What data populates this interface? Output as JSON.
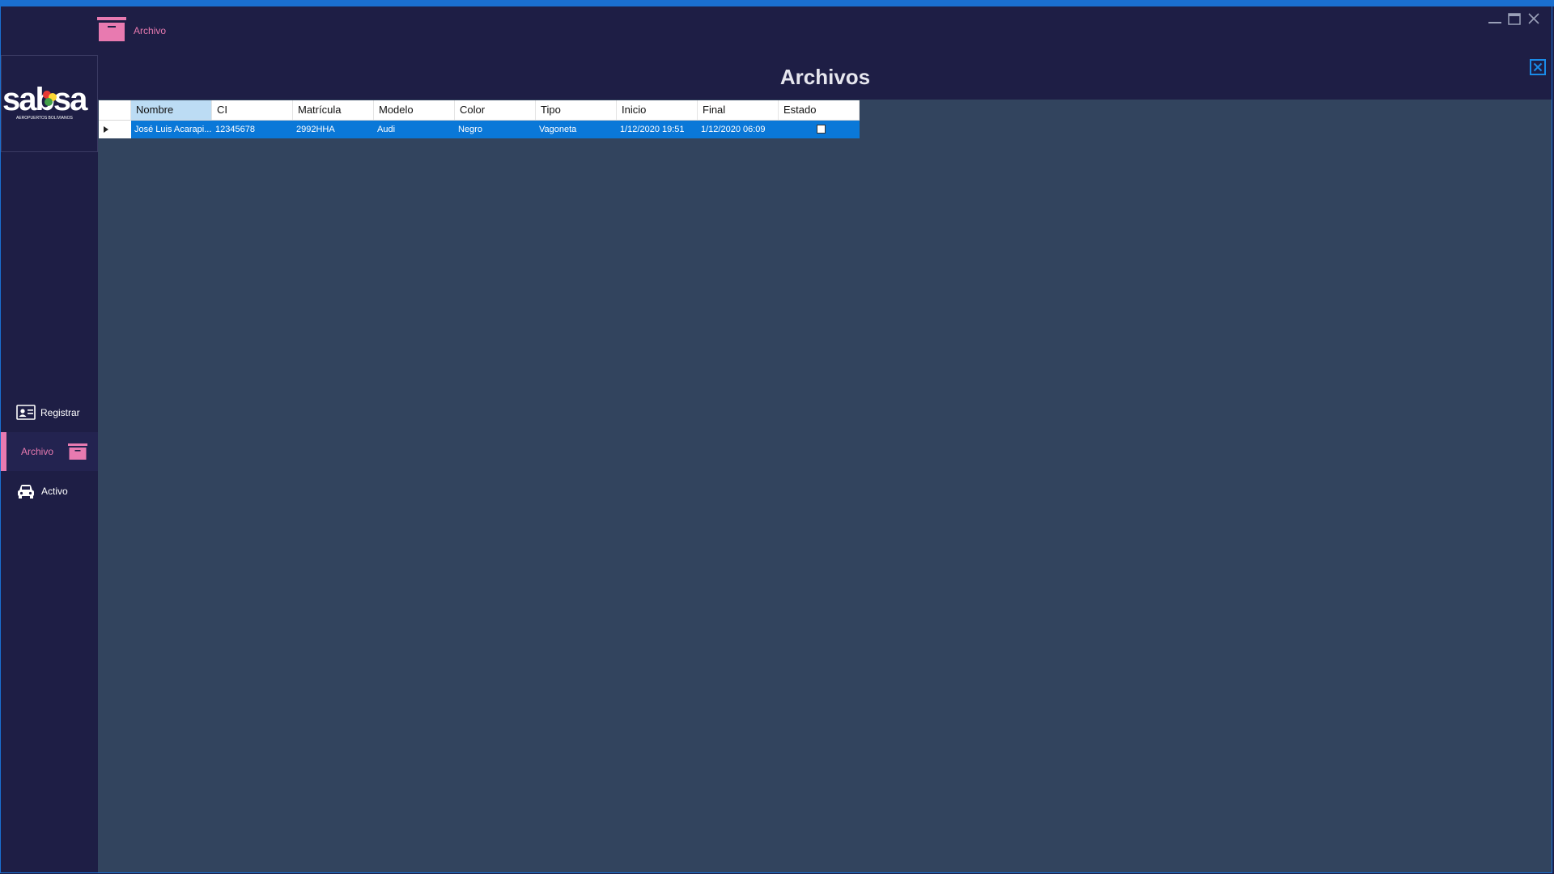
{
  "window": {
    "title": "Archivo"
  },
  "sidebar": {
    "logo_text": "sabsa",
    "logo_subtitle": "AEROPUERTOS BOLIVIANOS",
    "items": [
      {
        "label": "Registrar",
        "icon": "id-card-icon"
      },
      {
        "label": "Archivo",
        "icon": "archive-box-icon",
        "active": true
      },
      {
        "label": "Activo",
        "icon": "car-icon"
      }
    ]
  },
  "main": {
    "title": "Archivos",
    "grid": {
      "columns": [
        "Nombre",
        "CI",
        "Matrícula",
        "Modelo",
        "Color",
        "Tipo",
        "Inicio",
        "Final",
        "Estado"
      ],
      "rows": [
        {
          "nombre": "José Luis Acarapi...",
          "ci": "12345678",
          "matricula": "2992HHA",
          "modelo": "Audi",
          "color": "Negro",
          "tipo": "Vagoneta",
          "inicio": "1/12/2020 19:51",
          "final": "1/12/2020 06:09",
          "estado": false
        }
      ]
    }
  },
  "colors": {
    "accent": "#e87ab0",
    "selection": "#0a78d8",
    "sidebar_bg": "#1e1e45",
    "content_bg": "#32445e",
    "window_border": "#1a6fd0"
  }
}
